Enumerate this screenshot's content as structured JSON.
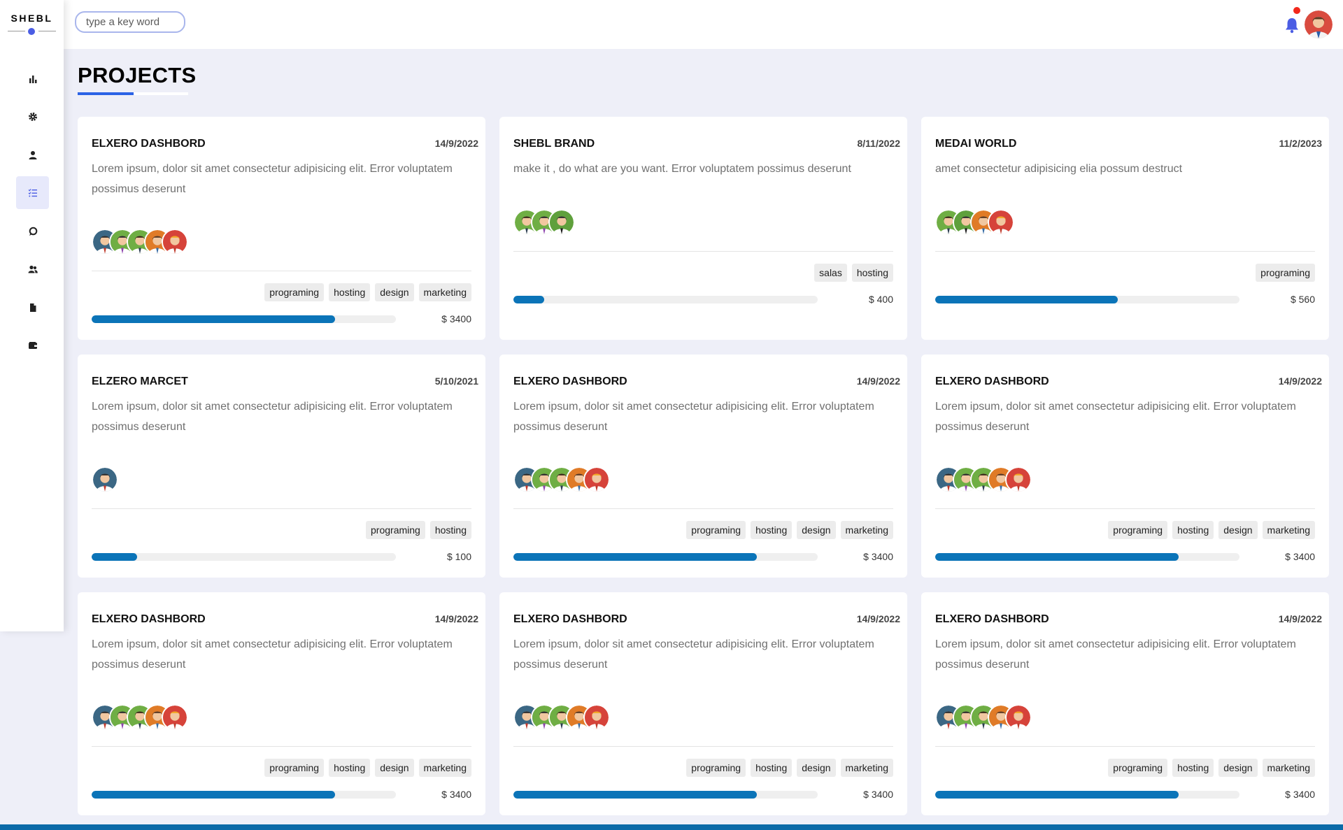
{
  "brand": {
    "name": "SHEBL",
    "accent": "#4b5de4"
  },
  "search": {
    "placeholder": "type a key word"
  },
  "header": {
    "bell_icon": "bell-icon",
    "has_notification": true,
    "profile_avatar": "profile-avatar"
  },
  "sidebar": {
    "items": [
      {
        "id": "dashboard",
        "icon": "chart-bar-icon",
        "active": false
      },
      {
        "id": "settings",
        "icon": "gear-icon",
        "active": false
      },
      {
        "id": "profile",
        "icon": "user-icon",
        "active": false
      },
      {
        "id": "projects",
        "icon": "list-check-icon",
        "active": true
      },
      {
        "id": "courses",
        "icon": "chat-bubble-icon",
        "active": false
      },
      {
        "id": "friends",
        "icon": "users-icon",
        "active": false
      },
      {
        "id": "files",
        "icon": "file-icon",
        "active": false
      },
      {
        "id": "plans",
        "icon": "wallet-icon",
        "active": false
      }
    ]
  },
  "page": {
    "title": "PROJECTS"
  },
  "projects": [
    {
      "name": "ELXERO DASHBORD",
      "date": "14/9/2022",
      "desc": "Lorem ipsum, dolor sit amet consectetur adipisicing elit. Error voluptatem possimus deserunt",
      "members": [
        "m1",
        "m2",
        "m3",
        "m4",
        "m5"
      ],
      "tags": [
        "programing",
        "hosting",
        "design",
        "marketing"
      ],
      "progress": 80,
      "price": "$ 3400"
    },
    {
      "name": "SHEBL BRAND",
      "date": "8/11/2022",
      "desc": "make it , do what are you want. Error voluptatem possimus deserunt",
      "members": [
        "m3",
        "m2",
        "m6"
      ],
      "tags": [
        "salas",
        "hosting"
      ],
      "progress": 10,
      "price": "$ 400"
    },
    {
      "name": "MEDAI WORLD",
      "date": "11/2/2023",
      "desc": "amet consectetur adipisicing elia possum destruct",
      "members": [
        "m3",
        "m6",
        "m4",
        "m5"
      ],
      "tags": [
        "programing"
      ],
      "progress": 60,
      "price": "$ 560"
    },
    {
      "name": "ELZERO MARCET",
      "date": "5/10/2021",
      "desc": "Lorem ipsum, dolor sit amet consectetur adipisicing elit. Error voluptatem possimus deserunt",
      "members": [
        "m1"
      ],
      "tags": [
        "programing",
        "hosting"
      ],
      "progress": 15,
      "price": "$ 100"
    },
    {
      "name": "ELXERO DASHBORD",
      "date": "14/9/2022",
      "desc": "Lorem ipsum, dolor sit amet consectetur adipisicing elit. Error voluptatem possimus deserunt",
      "members": [
        "m1",
        "m2",
        "m3",
        "m4",
        "m5"
      ],
      "tags": [
        "programing",
        "hosting",
        "design",
        "marketing"
      ],
      "progress": 80,
      "price": "$ 3400"
    },
    {
      "name": "ELXERO DASHBORD",
      "date": "14/9/2022",
      "desc": "Lorem ipsum, dolor sit amet consectetur adipisicing elit. Error voluptatem possimus deserunt",
      "members": [
        "m1",
        "m2",
        "m3",
        "m4",
        "m5"
      ],
      "tags": [
        "programing",
        "hosting",
        "design",
        "marketing"
      ],
      "progress": 80,
      "price": "$ 3400"
    },
    {
      "name": "ELXERO DASHBORD",
      "date": "14/9/2022",
      "desc": "Lorem ipsum, dolor sit amet consectetur adipisicing elit. Error voluptatem possimus deserunt",
      "members": [
        "m1",
        "m2",
        "m3",
        "m4",
        "m5"
      ],
      "tags": [
        "programing",
        "hosting",
        "design",
        "marketing"
      ],
      "progress": 80,
      "price": "$ 3400"
    },
    {
      "name": "ELXERO DASHBORD",
      "date": "14/9/2022",
      "desc": "Lorem ipsum, dolor sit amet consectetur adipisicing elit. Error voluptatem possimus deserunt",
      "members": [
        "m1",
        "m2",
        "m3",
        "m4",
        "m5"
      ],
      "tags": [
        "programing",
        "hosting",
        "design",
        "marketing"
      ],
      "progress": 80,
      "price": "$ 3400"
    },
    {
      "name": "ELXERO DASHBORD",
      "date": "14/9/2022",
      "desc": "Lorem ipsum, dolor sit amet consectetur adipisicing elit. Error voluptatem possimus deserunt",
      "members": [
        "m1",
        "m2",
        "m3",
        "m4",
        "m5"
      ],
      "tags": [
        "programing",
        "hosting",
        "design",
        "marketing"
      ],
      "progress": 80,
      "price": "$ 3400"
    }
  ],
  "colors": {
    "progress": "#0b74b8",
    "page_bg": "#eeeff8",
    "notification": "#f2281b"
  }
}
